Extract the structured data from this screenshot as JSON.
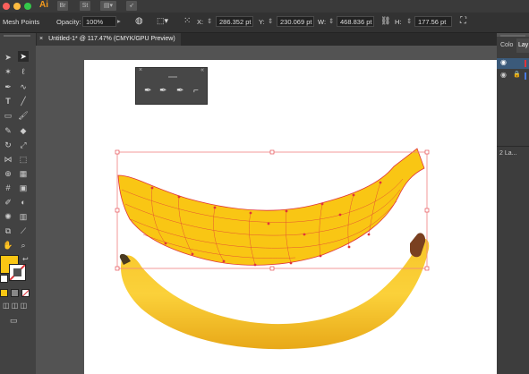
{
  "app": {
    "logo": "Ai",
    "bridge_label": "Br",
    "stock_label": "St"
  },
  "control_bar": {
    "mode_label": "Mesh Points",
    "opacity_label": "Opacity:",
    "opacity_value": "100%",
    "x_label": "X:",
    "x_value": "286.352 pt",
    "y_label": "Y:",
    "y_value": "230.069 pt",
    "w_label": "W:",
    "w_value": "468.836 pt",
    "h_label": "H:",
    "h_value": "177.56 pt"
  },
  "document": {
    "tab_title": "Untitled-1* @ 117.47% (CMYK/GPU Preview)",
    "close_glyph": "×"
  },
  "right_panel": {
    "tab_color": "Colo",
    "tab_layers": "Lay",
    "layers_count": "2 La..."
  },
  "colors": {
    "fill": "#f9c614",
    "mesh_stroke": "#e0343a",
    "bbox_stroke": "#f08080"
  },
  "icons": [
    "selection-icon",
    "direct-selection-icon",
    "magic-wand-icon",
    "lasso-icon",
    "pen-icon",
    "curvature-icon",
    "type-icon",
    "line-icon",
    "rectangle-icon",
    "paintbrush-icon",
    "shaper-icon",
    "eraser-icon",
    "rotate-icon",
    "scale-icon",
    "width-icon",
    "free-transform-icon",
    "shape-builder-icon",
    "perspective-icon",
    "mesh-icon",
    "gradient-icon",
    "eyedropper-icon",
    "blend-icon",
    "symbol-sprayer-icon",
    "column-graph-icon",
    "artboard-icon",
    "slice-icon",
    "hand-icon",
    "zoom-icon"
  ]
}
